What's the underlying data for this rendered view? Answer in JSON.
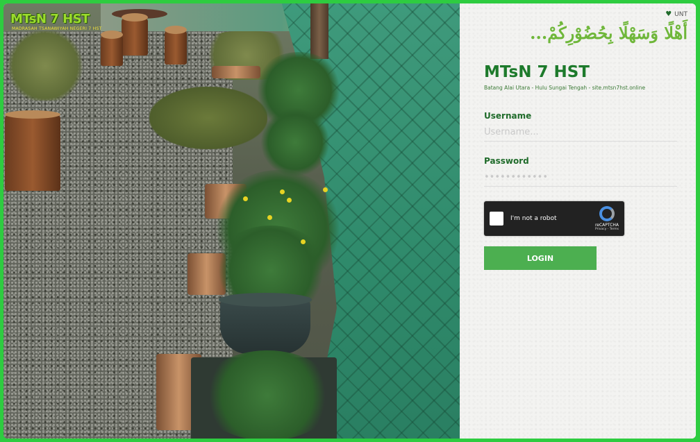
{
  "logo": {
    "text": "MTsN 7 HST",
    "tagline": "MADRASAH TSANAWIYAH NEGERI 7 HST"
  },
  "panel": {
    "top_right_label": "UNT",
    "greeting": "أَهْلًا وَسَهْلًا بِحُضُوْرِكُمْ...",
    "title": "MTsN 7 HST",
    "subtitle": "Batang Alai Utara - Hulu Sungai Tengah - site.mtsn7hst.online",
    "username_label": "Username",
    "username_placeholder": "Username...",
    "password_label": "Password",
    "password_placeholder": "••••••••••••",
    "captcha_text": "I'm not a robot",
    "captcha_brand": "reCAPTCHA",
    "captcha_links": "Privacy - Terms",
    "login_label": "LOGIN"
  },
  "colors": {
    "frame": "#2ecc40",
    "title": "#1d7a2b",
    "button": "#4caf50"
  }
}
